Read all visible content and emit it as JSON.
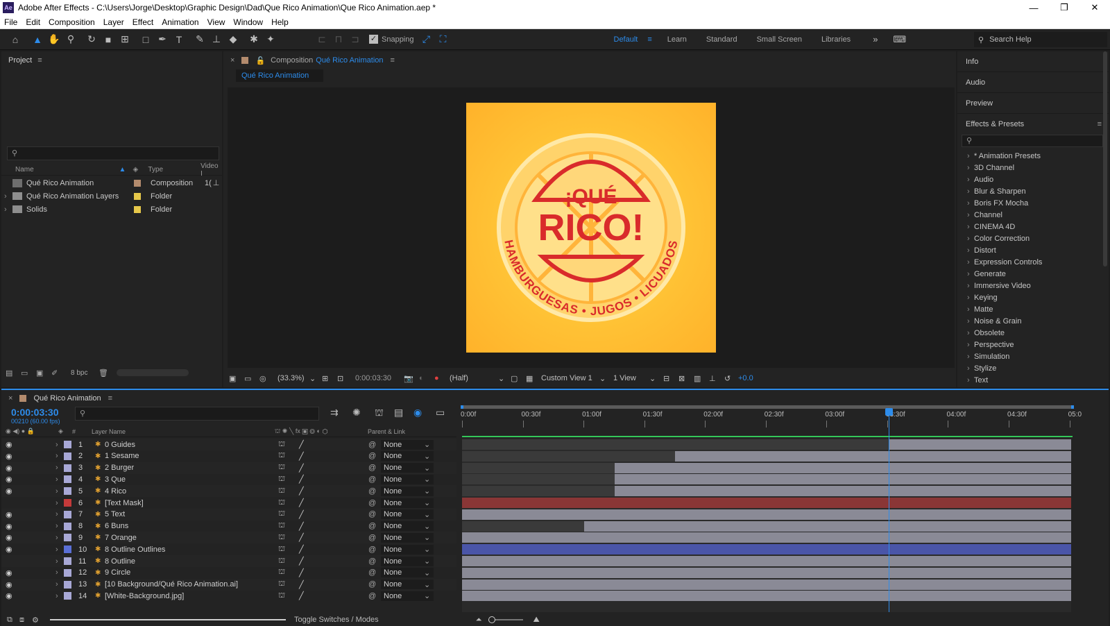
{
  "window": {
    "app_icon": "Ae",
    "title": "Adobe After Effects - C:\\Users\\Jorge\\Desktop\\Graphic Design\\Dad\\Que Rico Animation\\Que Rico Animation.aep *",
    "minimize": "—",
    "restore": "❐",
    "close": "✕"
  },
  "menu": [
    "File",
    "Edit",
    "Composition",
    "Layer",
    "Effect",
    "Animation",
    "View",
    "Window",
    "Help"
  ],
  "toolbar": {
    "snapping_label": "Snapping",
    "workspaces": [
      "Default",
      "Learn",
      "Standard",
      "Small Screen",
      "Libraries"
    ],
    "active_workspace": "Default",
    "search_placeholder": "Search Help"
  },
  "project": {
    "title": "Project",
    "columns": [
      "Name",
      "Type",
      "Video I"
    ],
    "bpc": "8 bpc",
    "items": [
      {
        "name": "Qué Rico Animation",
        "type": "Composition",
        "extra": "1(",
        "color": "#b38b6d"
      },
      {
        "name": "Qué Rico Animation Layers",
        "type": "Folder",
        "extra": "",
        "color": "#e6c84a"
      },
      {
        "name": "Solids",
        "type": "Folder",
        "extra": "",
        "color": "#e6c84a"
      }
    ]
  },
  "composition": {
    "label": "Composition",
    "name": "Qué Rico Animation",
    "tab": "Qué Rico Animation",
    "artwork": {
      "top": "¡QUÉ",
      "main": "RICO!",
      "ring": "HAMBURGUESAS • JUGOS • LICUADOS"
    },
    "footer": {
      "zoom": "(33.3%)",
      "timecode": "0:00:03:30",
      "resolution": "(Half)",
      "view": "Custom View 1",
      "views": "1 View",
      "exposure": "+0.0"
    }
  },
  "right_panel": {
    "sections": [
      "Info",
      "Audio",
      "Preview"
    ],
    "effects_title": "Effects & Presets",
    "effects": [
      "* Animation Presets",
      "3D Channel",
      "Audio",
      "Blur & Sharpen",
      "Boris FX Mocha",
      "Channel",
      "CINEMA 4D",
      "Color Correction",
      "Distort",
      "Expression Controls",
      "Generate",
      "Immersive Video",
      "Keying",
      "Matte",
      "Noise & Grain",
      "Obsolete",
      "Perspective",
      "Simulation",
      "Stylize",
      "Text"
    ]
  },
  "timeline": {
    "comp_name": "Qué Rico Animation",
    "timecode": "0:00:03:30",
    "frames": "00210 (60.00 fps)",
    "column_headers": {
      "num": "#",
      "layer_name": "Layer Name",
      "parent": "Parent & Link"
    },
    "ruler": [
      "0:00f",
      "00:30f",
      "01:00f",
      "01:30f",
      "02:00f",
      "02:30f",
      "03:00f",
      "03:30f",
      "04:00f",
      "04:30f",
      "05:0"
    ],
    "playhead_fraction": 0.7,
    "toggle_label": "Toggle Switches / Modes",
    "layers": [
      {
        "num": "1",
        "name": "0 Guides",
        "parent": "None",
        "visible": true,
        "label": "#a8a8d6",
        "start": 0.0,
        "bar": "#8a8a96",
        "dark_until": 0.7
      },
      {
        "num": "2",
        "name": "1 Sesame",
        "parent": "None",
        "visible": true,
        "label": "#a8a8d6",
        "start": 0.0,
        "bar": "#8a8a96",
        "dark_until": 0.35
      },
      {
        "num": "3",
        "name": "2 Burger",
        "parent": "None",
        "visible": true,
        "label": "#a8a8d6",
        "start": 0.0,
        "bar": "#8a8a96",
        "dark_until": 0.25
      },
      {
        "num": "4",
        "name": "3 Que",
        "parent": "None",
        "visible": true,
        "label": "#a8a8d6",
        "start": 0.0,
        "bar": "#8a8a96",
        "dark_until": 0.25
      },
      {
        "num": "5",
        "name": "4 Rico",
        "parent": "None",
        "visible": true,
        "label": "#a8a8d6",
        "start": 0.0,
        "bar": "#8a8a96",
        "dark_until": 0.25
      },
      {
        "num": "6",
        "name": "[Text Mask]",
        "parent": "None",
        "visible": false,
        "label": "#c43a3a",
        "start": 0.0,
        "bar": "#8a3636",
        "dark_until": 0.0
      },
      {
        "num": "7",
        "name": "5 Text",
        "parent": "None",
        "visible": true,
        "label": "#a8a8d6",
        "start": 0.0,
        "bar": "#8a8a96",
        "dark_until": 0.0
      },
      {
        "num": "8",
        "name": "6 Buns",
        "parent": "None",
        "visible": true,
        "label": "#a8a8d6",
        "start": 0.0,
        "bar": "#8a8a96",
        "dark_until": 0.2
      },
      {
        "num": "9",
        "name": "7 Orange",
        "parent": "None",
        "visible": true,
        "label": "#a8a8d6",
        "start": 0.0,
        "bar": "#8a8a96",
        "dark_until": 0.0
      },
      {
        "num": "10",
        "name": "8 Outline Outlines",
        "parent": "None",
        "visible": true,
        "label": "#5a6fd6",
        "start": 0.0,
        "bar": "#4a55a8",
        "dark_until": 0.0
      },
      {
        "num": "11",
        "name": "8 Outline",
        "parent": "None",
        "visible": false,
        "label": "#a8a8d6",
        "start": 0.0,
        "bar": "#8a8a96",
        "dark_until": 0.0
      },
      {
        "num": "12",
        "name": "9 Circle",
        "parent": "None",
        "visible": true,
        "label": "#a8a8d6",
        "start": 0.0,
        "bar": "#8a8a96",
        "dark_until": 0.0
      },
      {
        "num": "13",
        "name": "[10 Background/Qué Rico Animation.ai]",
        "parent": "None",
        "visible": true,
        "label": "#a8a8d6",
        "start": 0.0,
        "bar": "#8a8a96",
        "dark_until": 0.0
      },
      {
        "num": "14",
        "name": "[White-Background.jpg]",
        "parent": "None",
        "visible": true,
        "label": "#a8a8d6",
        "start": 0.0,
        "bar": "#8a8a96",
        "dark_until": 0.0
      }
    ]
  }
}
